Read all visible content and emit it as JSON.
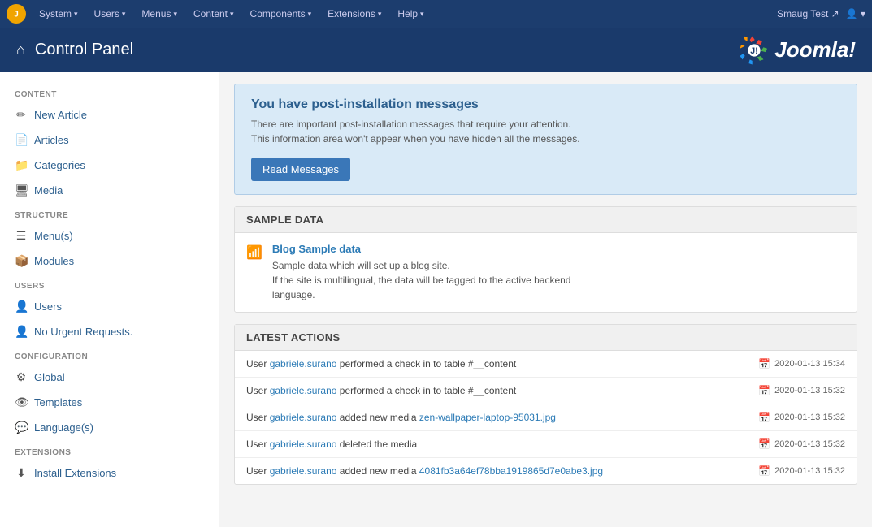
{
  "topnav": {
    "logo_text": "J",
    "items": [
      {
        "label": "System",
        "id": "system"
      },
      {
        "label": "Users",
        "id": "users"
      },
      {
        "label": "Menus",
        "id": "menus"
      },
      {
        "label": "Content",
        "id": "content"
      },
      {
        "label": "Components",
        "id": "components"
      },
      {
        "label": "Extensions",
        "id": "extensions"
      },
      {
        "label": "Help",
        "id": "help"
      }
    ],
    "right_user": "Smaug Test",
    "right_link_icon": "↗"
  },
  "header": {
    "title": "Control Panel",
    "joomla_text": "Joomla!"
  },
  "sidebar": {
    "sections": [
      {
        "title": "CONTENT",
        "items": [
          {
            "label": "New Article",
            "icon": "✏",
            "id": "new-article"
          },
          {
            "label": "Articles",
            "icon": "📄",
            "id": "articles"
          },
          {
            "label": "Categories",
            "icon": "📁",
            "id": "categories"
          },
          {
            "label": "Media",
            "icon": "🖥",
            "id": "media"
          }
        ]
      },
      {
        "title": "STRUCTURE",
        "items": [
          {
            "label": "Menu(s)",
            "icon": "☰",
            "id": "menus"
          },
          {
            "label": "Modules",
            "icon": "📦",
            "id": "modules"
          }
        ]
      },
      {
        "title": "USERS",
        "items": [
          {
            "label": "Users",
            "icon": "👤",
            "id": "users"
          },
          {
            "label": "No Urgent Requests.",
            "icon": "👤",
            "id": "no-urgent"
          }
        ]
      },
      {
        "title": "CONFIGURATION",
        "items": [
          {
            "label": "Global",
            "icon": "⚙",
            "id": "global"
          },
          {
            "label": "Templates",
            "icon": "👁",
            "id": "templates"
          },
          {
            "label": "Language(s)",
            "icon": "💬",
            "id": "languages"
          }
        ]
      },
      {
        "title": "EXTENSIONS",
        "items": [
          {
            "label": "Install Extensions",
            "icon": "⬇",
            "id": "install-extensions"
          }
        ]
      }
    ]
  },
  "post_install": {
    "title": "You have post-installation messages",
    "line1": "There are important post-installation messages that require your attention.",
    "line2": "This information area won't appear when you have hidden all the messages.",
    "btn_label": "Read Messages"
  },
  "sample_data": {
    "header": "SAMPLE DATA",
    "item": {
      "title": "Blog Sample data",
      "icon": "📶",
      "desc_line1": "Sample data which will set up a blog site.",
      "desc_line2": "If the site is multilingual, the data will be tagged to the active backend",
      "desc_line3": "language."
    }
  },
  "latest_actions": {
    "header": "LATEST ACTIONS",
    "rows": [
      {
        "prefix": "User",
        "user": "gabriele.surano",
        "action": " performed a check in to table #__content",
        "time": "2020-01-13 15:34"
      },
      {
        "prefix": "User",
        "user": "gabriele.surano",
        "action": " performed a check in to table #__content",
        "time": "2020-01-13 15:32"
      },
      {
        "prefix": "User",
        "user": "gabriele.surano",
        "action": " added new media ",
        "link": "zen-wallpaper-laptop-95031.jpg",
        "time": "2020-01-13 15:32"
      },
      {
        "prefix": "User",
        "user": "gabriele.surano",
        "action": " deleted the media",
        "time": "2020-01-13 15:32"
      },
      {
        "prefix": "User",
        "user": "gabriele.surano",
        "action": " added new media ",
        "link": "4081fb3a64ef78bba1919865d7e0abe3.jpg",
        "time": "2020-01-13 15:32"
      }
    ]
  },
  "icons": {
    "home": "⌂",
    "calendar": "📅",
    "caret": "▾"
  }
}
